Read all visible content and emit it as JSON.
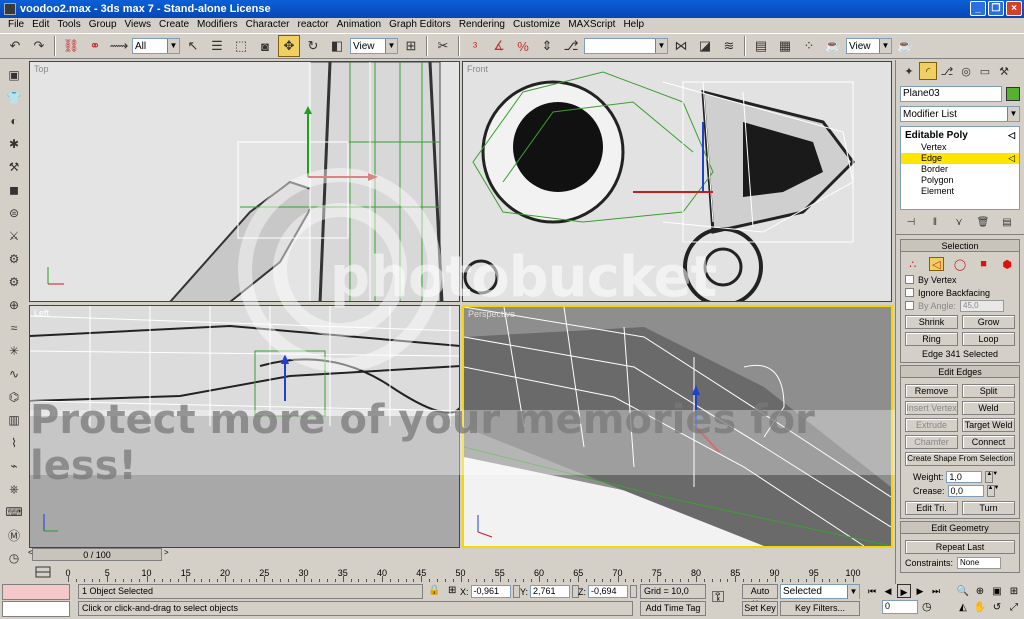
{
  "window": {
    "title": "voodoo2.max - 3ds max 7 - Stand-alone License"
  },
  "menu": [
    "File",
    "Edit",
    "Tools",
    "Group",
    "Views",
    "Create",
    "Modifiers",
    "Character",
    "reactor",
    "Animation",
    "Graph Editors",
    "Rendering",
    "Customize",
    "MAXScript",
    "Help"
  ],
  "toolbar": {
    "selection_filter": "All",
    "ref_coord": "View",
    "named_selection": "",
    "render_coord": "View"
  },
  "viewports": {
    "top": "Top",
    "front": "Front",
    "left": "Left",
    "perspective": "Perspective"
  },
  "panel": {
    "object_name": "Plane03",
    "object_color": "#58b030",
    "modifier_list": "Modifier List",
    "stack": {
      "root": "Editable Poly",
      "items": [
        "Vertex",
        "Edge",
        "Border",
        "Polygon",
        "Element"
      ],
      "selected": "Edge"
    },
    "selection": {
      "title": "Selection",
      "by_vertex": "By Vertex",
      "ignore_backfacing": "Ignore Backfacing",
      "by_angle": "By Angle:",
      "angle_value": "45,0",
      "shrink": "Shrink",
      "grow": "Grow",
      "ring": "Ring",
      "loop": "Loop",
      "status": "Edge 341 Selected"
    },
    "edit_edges": {
      "title": "Edit Edges",
      "remove": "Remove",
      "split": "Split",
      "insert_vertex": "Insert Vertex",
      "weld": "Weld",
      "extrude": "Extrude",
      "target_weld": "Target Weld",
      "chamfer": "Chamfer",
      "connect": "Connect",
      "create_shape": "Create Shape From Selection",
      "weight_label": "Weight:",
      "weight": "1,0",
      "crease_label": "Crease:",
      "crease": "0,0",
      "edit_tri": "Edit Tri.",
      "turn": "Turn"
    },
    "edit_geometry": {
      "title": "Edit Geometry",
      "repeat_last": "Repeat Last",
      "constraints": "Constraints:",
      "constraints_value": "None"
    }
  },
  "timeline": {
    "frame_display": "0 / 100",
    "ticks": [
      0,
      5,
      10,
      15,
      20,
      25,
      30,
      35,
      40,
      45,
      50,
      55,
      60,
      65,
      70,
      75,
      80,
      85,
      90,
      95,
      100
    ]
  },
  "status": {
    "selected": "1 Object Selected",
    "prompt": "Click or click-and-drag to select objects",
    "x_label": "X:",
    "x": "-0,961",
    "y_label": "Y:",
    "y": "2,761",
    "z_label": "Z:",
    "z": "-0,694",
    "grid": "Grid = 10,0",
    "add_time_tag": "Add Time Tag",
    "auto_key": "Auto Key",
    "set_key": "Set Key",
    "key_mode": "Selected",
    "key_filters": "Key Filters...",
    "frame": "0"
  },
  "watermark": {
    "brand": "photobucket",
    "line": "Protect more of your memories for less!"
  },
  "colors": {
    "titlebar": "#0a5fd8",
    "selected_row": "#ffe400",
    "viewport_active": "#f0d800"
  }
}
